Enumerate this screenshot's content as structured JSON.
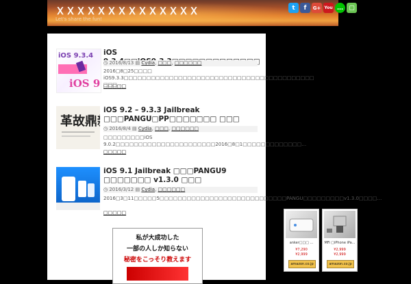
{
  "site": {
    "title": "ＸＸＸＸＸＸＸＸＸＸＸＸＸＸ",
    "tagline": "Let's share the fun!"
  },
  "social": [
    {
      "label": "t",
      "icon": "twitter-icon",
      "color": "#1da1f2"
    },
    {
      "label": "f",
      "icon": "facebook-icon",
      "color": "#3b5998"
    },
    {
      "label": "G+",
      "icon": "google-plus-icon",
      "color": "#dd4b39"
    },
    {
      "label": "You",
      "icon": "youtube-icon",
      "color": "#cc181e"
    },
    {
      "label": "…",
      "icon": "line-icon",
      "color": "#00c300"
    },
    {
      "label": "▢",
      "icon": "feedly-icon",
      "color": "#6cc655"
    }
  ],
  "articles": [
    {
      "title": "iOS 9.3.4□□iOS9.3.3□□□□□□□□□□□□□",
      "date": "2016/8/13",
      "cats": [
        "Cydia",
        "□□□",
        "□□□□□□"
      ],
      "excerpt": "2016□8□25□□□□ iOS9.3.3□□□□□□□□□□□□□□□□□□□□□□□□□□□□□□□□□□□□□□□□□□ □□□…",
      "more": "□□□□□"
    },
    {
      "title": "iOS 9.2 – 9.3.3 Jailbreak □□□PANGU□PP□□□□□□□ □□□",
      "date": "2016/8/4",
      "cats": [
        "Cydia",
        "□□□",
        "□□□□□□"
      ],
      "excerpt": "□□□□□□□□□iOS 9.0.2□□□□□□□□□□□□□□□□□□□□□□2016□8□1□□□□□□□□□□□□□…",
      "more": "□□□□□"
    },
    {
      "title": "iOS 9.1 Jailbreak □□□PANGU9 □□□□□□□ v1.3.0 □□□",
      "date": "2016/3/12",
      "cats": [
        "Cydia",
        "□□□□□□"
      ],
      "excerpt": "2016□3□11□□□□□5□□□□□□□□□□□□□□□□□□□□□□□□□□□□PANGU□□□□□□□□□v1.3.0□□□□…",
      "more": "□□□□□"
    }
  ],
  "ad": {
    "line1": "私が大成功した",
    "line2": "一部の人しか知らない",
    "line3": "秘密をこっそり教えます"
  },
  "sidebar_products": [
    {
      "name": "anker□□□ ...",
      "price": "¥7,290",
      "price2": "¥2,999",
      "button": "amazon.co.jp"
    },
    {
      "name": "MFi □iPhone iPa...",
      "price": "¥2,999",
      "price2": "¥2,999",
      "button": "amazon.co.jp"
    }
  ]
}
